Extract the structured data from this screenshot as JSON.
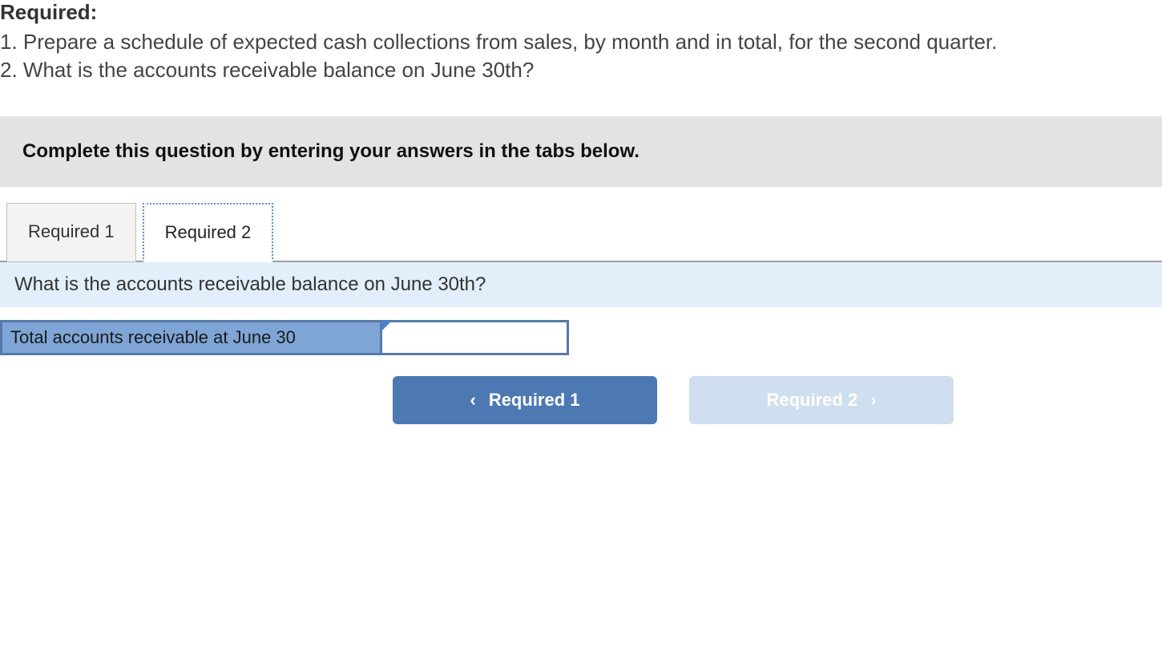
{
  "question": {
    "required_title": "Required:",
    "items": [
      "1. Prepare a schedule of expected cash collections from sales, by month and in total, for the second quarter.",
      "2. What is the accounts receivable balance on June 30th?"
    ]
  },
  "instruction": "Complete this question by entering your answers in the tabs below.",
  "tabs": [
    {
      "label": "Required 1",
      "active": false
    },
    {
      "label": "Required 2",
      "active": true
    }
  ],
  "prompt": "What is the accounts receivable balance on June 30th?",
  "answer_row": {
    "label": "Total accounts receivable at June 30",
    "value": ""
  },
  "nav": {
    "prev": {
      "label": "Required 1",
      "icon": "‹"
    },
    "next": {
      "label": "Required 2",
      "icon": "›"
    }
  }
}
